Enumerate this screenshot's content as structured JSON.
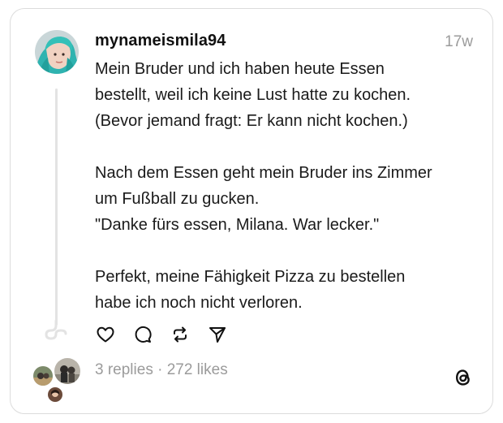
{
  "post": {
    "username": "mynameismila94",
    "timestamp": "17w",
    "paragraphs": [
      {
        "lines": [
          "Mein Bruder und ich haben heute Essen",
          "bestellt, weil ich keine Lust hatte zu kochen.",
          "(Bevor jemand fragt: Er kann nicht kochen.)"
        ]
      },
      {
        "lines": [
          "Nach dem Essen geht mein Bruder ins Zimmer",
          "um Fußball zu gucken.",
          "\"Danke fürs essen, Milana. War lecker.\""
        ]
      },
      {
        "lines": [
          "Perfekt, meine Fähigkeit Pizza zu bestellen",
          "habe ich noch nicht verloren."
        ]
      }
    ],
    "stats": "3 replies · 272 likes"
  },
  "icons": {
    "like": "heart-icon",
    "reply": "comment-icon",
    "repost": "repost-icon",
    "share": "send-icon",
    "brand": "threads-logo-icon"
  },
  "colors": {
    "text": "#1a1a1a",
    "muted": "#9b9b9b",
    "border": "#dcdcdc",
    "thread_line": "#e3e3e3"
  }
}
